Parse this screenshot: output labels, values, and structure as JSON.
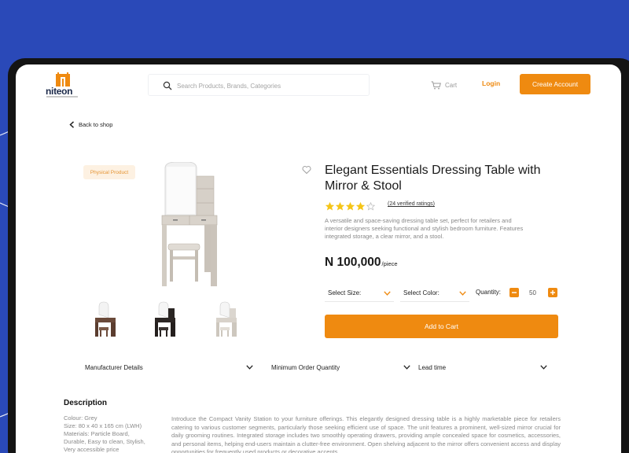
{
  "brand": {
    "logo_text": "niteon"
  },
  "header": {
    "search_placeholder": "Search Products, Brands, Categories",
    "cart_label": "Cart",
    "login_label": "Login",
    "create_account_label": "Create Account"
  },
  "nav": {
    "back_label": "Back to shop"
  },
  "product": {
    "badge": "Physical Product",
    "title": "Elegant Essentials Dressing Table with Mirror & Stool",
    "rating": 4,
    "rating_max": 5,
    "ratings_text": "(24 verified ratings)",
    "short_description": "A versatile and space-saving dressing table set, perfect for retailers and interior designers seeking functional and stylish bedroom furniture. Features integrated storage, a clear mirror, and a stool.",
    "price": "N 100,000",
    "price_unit": "/piece",
    "select_size": "Select Size:",
    "select_color": "Select Color:",
    "quantity_label": "Quantity:",
    "quantity_value": "50",
    "add_to_cart": "Add to Cart"
  },
  "accordions": [
    "Manufacturer Details",
    "Minimum Order Quantity",
    "Lead time"
  ],
  "description": {
    "title": "Description",
    "specs": [
      "Colour: Grey",
      "Size: 80 x 40 x 165 cm (LWH)",
      "Materials: Particle Board,",
      "Durable, Easy to clean, Stylish,",
      "Very accessible price"
    ],
    "text": "Introduce the Compact Vanity Station to your furniture offerings. This elegantly designed dressing table is a highly marketable piece for retailers catering to various customer segments, particularly those seeking efficient use of space. The unit features a prominent, well-sized mirror crucial for daily grooming routines. Integrated storage includes two smoothly operating drawers, providing ample concealed space for cosmetics, accessories, and personal items, helping end-users maintain a clutter-free environment. Open shelving adjacent to the mirror offers convenient access and display opportunities for frequently used products or decorative accents."
  },
  "colors": {
    "accent": "#ef8a10",
    "background": "#2a49b8",
    "badge_bg": "#fdf1e2",
    "star": "#f5c518"
  },
  "icons": [
    "search-icon",
    "cart-icon",
    "arrow-left-icon",
    "heart-icon",
    "star-icon",
    "chevron-down-icon",
    "minus-icon",
    "plus-icon"
  ]
}
